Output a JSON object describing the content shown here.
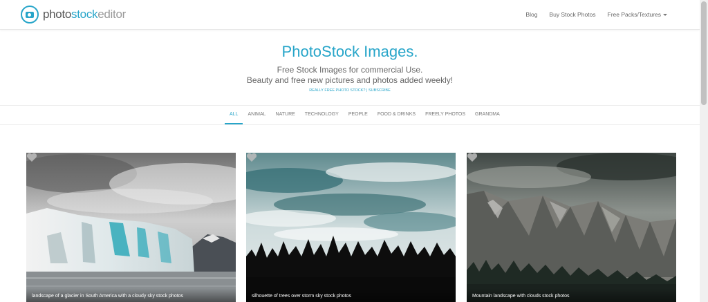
{
  "brand": {
    "part1": "photo",
    "part2": "stock",
    "part3": "editor"
  },
  "nav": {
    "links": [
      "Blog",
      "Buy Stock Photos",
      "Free Packs/Textures"
    ]
  },
  "hero": {
    "title": "PhotoStock Images.",
    "subtitle1": "Free Stock Images for commercial Use.",
    "subtitle2": "Beauty and free new pictures and photos added weekly!",
    "link1": "REALLY FREE PHOTO STOCK?",
    "separator": " | ",
    "link2": "SUBSCRIBE"
  },
  "filters": {
    "items": [
      "ALL",
      "ANIMAL",
      "NATURE",
      "TECHNOLOGY",
      "PEOPLE",
      "FOOD & DRINKS",
      "FREELY PHOTOS",
      "GRANDMA"
    ],
    "active": "ALL"
  },
  "cards": [
    {
      "caption": "landscape of a glacier in South America with a cloudy sky stock photos"
    },
    {
      "caption": "silhouette of trees over storm sky stock photos"
    },
    {
      "caption": "Mountain landscape with clouds stock photos"
    }
  ],
  "colors": {
    "accent": "#27a5c9"
  }
}
